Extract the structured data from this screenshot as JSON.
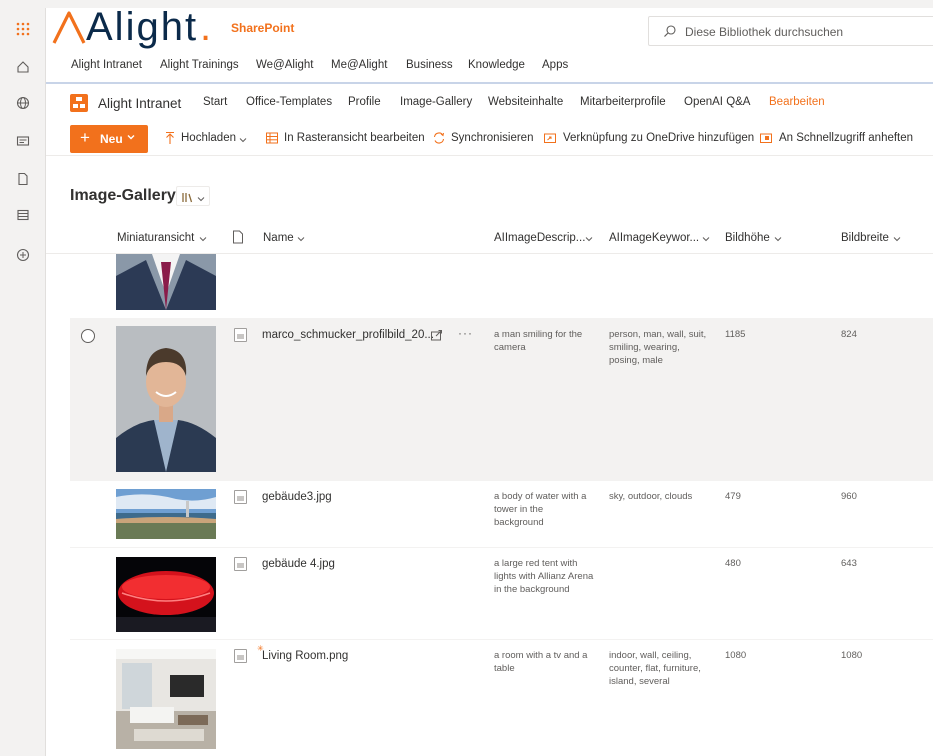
{
  "brand": {
    "logo_text": "Alight",
    "logo_dot": ".",
    "app_label": "SharePoint"
  },
  "search": {
    "placeholder": "Diese Bibliothek durchsuchen"
  },
  "hub_nav": [
    "Alight Intranet",
    "Alight Trainings",
    "We@Alight",
    "Me@Alight",
    "Business",
    "Knowledge",
    "Apps"
  ],
  "site_nav": {
    "title": "Alight Intranet",
    "items": [
      "Start",
      "Office-Templates",
      "Profile",
      "Image-Gallery",
      "Websiteinhalte",
      "Mitarbeiterprofile",
      "OpenAI Q&A",
      "Bearbeiten"
    ]
  },
  "commands": {
    "new_label": "Neu",
    "upload": "Hochladen",
    "grid_edit": "In Rasteransicht bearbeiten",
    "sync": "Synchronisieren",
    "onedrive": "Verknüpfung zu OneDrive hinzufügen",
    "pin": "An Schnellzugriff anheften"
  },
  "library": {
    "title": "Image-Gallery"
  },
  "columns": {
    "thumb": "Miniaturansicht",
    "name": "Name",
    "desc": "AIImageDescrip...",
    "keywords": "AIImageKeywor...",
    "height": "Bildhöhe",
    "width": "Bildbreite"
  },
  "rows": [
    {
      "name": "marco_schmucker_profilbild_20...",
      "desc": "a man smiling for the camera",
      "keywords": "person, man, wall, suit, smiling, wearing, posing, male",
      "height": "1185",
      "width": "824"
    },
    {
      "name": "gebäude3.jpg",
      "desc": "a body of water with a tower in the background",
      "keywords": "sky, outdoor, clouds",
      "height": "479",
      "width": "960"
    },
    {
      "name": "gebäude 4.jpg",
      "desc": "a large red tent with lights with Allianz Arena in the background",
      "keywords": "",
      "height": "480",
      "width": "643"
    },
    {
      "name": "Living Room.png",
      "desc": "a room with a tv and a table",
      "keywords": "indoor, wall, ceiling, counter, flat, furniture, island, several",
      "height": "1080",
      "width": "1080"
    }
  ],
  "colors": {
    "accent": "#f2711c",
    "navy": "#0b2a4a",
    "selected_row": "#f3f2f1"
  }
}
